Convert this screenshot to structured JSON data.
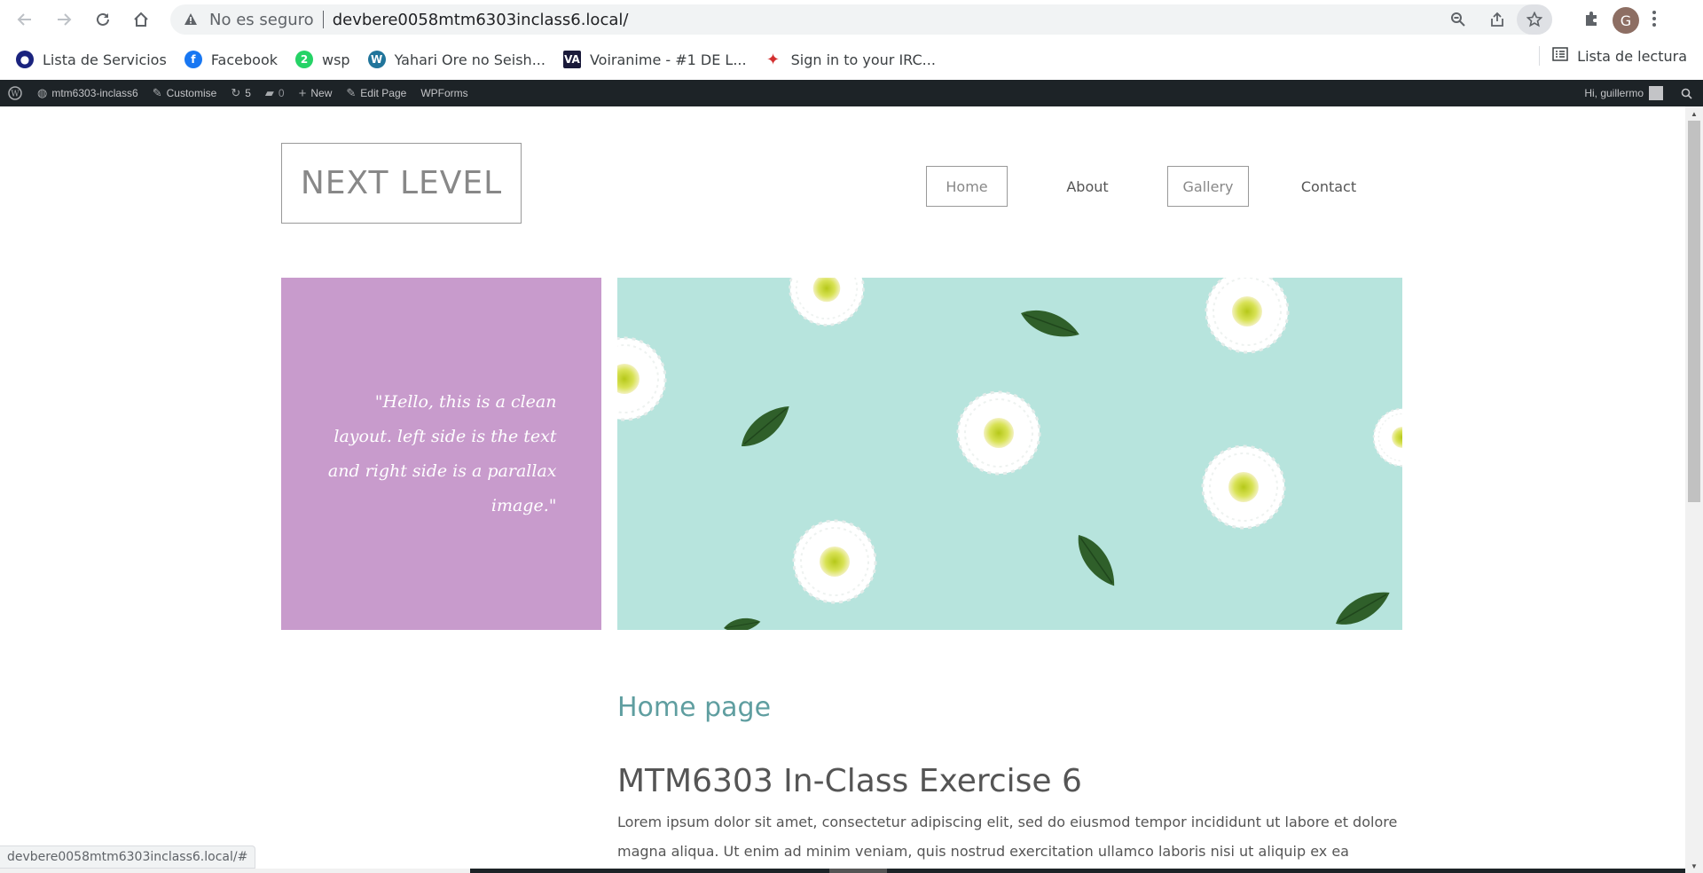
{
  "browser": {
    "insecure_label": "No es seguro",
    "url": "devbere0058mtm6303inclass6.local/",
    "profile_initial": "G",
    "status_url": "devbere0058mtm6303inclass6.local/#"
  },
  "bookmarks": [
    {
      "label": "Lista de Servicios",
      "color": "#1a237e"
    },
    {
      "label": "Facebook",
      "color": "#1877f2"
    },
    {
      "label": "wsp",
      "color": "#25d366"
    },
    {
      "label": "Yahari Ore no Seish...",
      "color": "#21759b"
    },
    {
      "label": "Voiranime - #1 DE L...",
      "color": "#1a1a3a"
    },
    {
      "label": "Sign in to your IRC...",
      "color": "#d32f2f"
    }
  ],
  "reading_list": "Lista de lectura",
  "adminbar": {
    "site": "mtm6303-inclass6",
    "customise": "Customise",
    "updates": "5",
    "comments": "0",
    "new": "New",
    "edit": "Edit Page",
    "wpforms": "WPForms",
    "greeting": "Hi, guillermo"
  },
  "site": {
    "logo": "NEXT LEVEL",
    "menu": [
      "Home",
      "About",
      "Gallery",
      "Contact"
    ],
    "quote": "\"Hello, this is a clean layout. left side is the text and right side is a parallax image.\"",
    "page_title": "Home page",
    "post_title": "MTM6303 In-Class Exercise 6",
    "post_body": "Lorem ipsum dolor sit amet, consectetur adipiscing elit, sed do eiusmod tempor incididunt ut labore et dolore magna aliqua. Ut enim ad minim veniam, quis nostrud exercitation ullamco laboris nisi ut aliquip ex ea commodo"
  },
  "colors": {
    "quote_bg": "#c89bcc",
    "hero_bg": "#b7e4dd",
    "page_title": "#5f9ea0",
    "adminbar_bg": "#1d2327"
  }
}
